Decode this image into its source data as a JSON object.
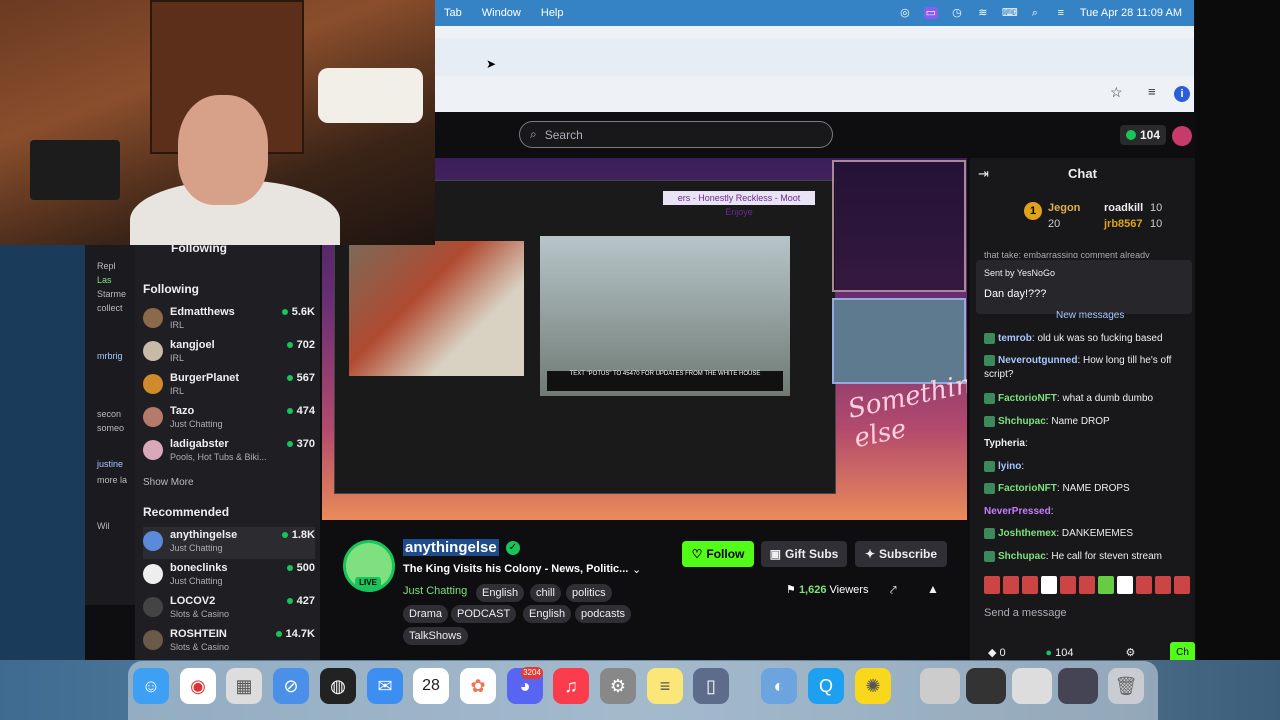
{
  "menubar": {
    "items": [
      "Tab",
      "Window",
      "Help"
    ],
    "datetime": "Tue Apr 28  11:09 AM"
  },
  "twitch": {
    "search_placeholder": "Search",
    "points": "104"
  },
  "sidebar": {
    "following_header": "Following",
    "following_label": "Following",
    "following": [
      {
        "name": "Edmatthews",
        "category": "IRL",
        "viewers": "5.6K"
      },
      {
        "name": "kangjoel",
        "category": "IRL",
        "viewers": "702"
      },
      {
        "name": "BurgerPlanet",
        "category": "IRL",
        "viewers": "567"
      },
      {
        "name": "Tazo",
        "category": "Just Chatting",
        "viewers": "474"
      },
      {
        "name": "ladigabster",
        "category": "Pools, Hot Tubs & Biki...",
        "viewers": "370"
      }
    ],
    "show_more": "Show More",
    "recommended_label": "Recommended",
    "recommended": [
      {
        "name": "anythingelse",
        "category": "Just Chatting",
        "viewers": "1.8K"
      },
      {
        "name": "boneclinks",
        "category": "Just Chatting",
        "viewers": "500"
      },
      {
        "name": "LOCOV2",
        "category": "Slots & Casino",
        "viewers": "427"
      },
      {
        "name": "ROSHTEIN",
        "category": "Slots & Casino",
        "viewers": "14.7K"
      }
    ],
    "strip_lines": [
      "Repl",
      "Las",
      "Starme",
      "collect",
      "mrbrig",
      "secon",
      "someo",
      "justine",
      "more la",
      "Wil"
    ]
  },
  "video": {
    "overlay_title": "ers - Honestly Reckless - Moot Enjoye",
    "signature": "Something else",
    "caption": "TEXT \"POTUS\" TO 45470 FOR UPDATES FROM THE WHITE HOUSE"
  },
  "channel": {
    "name": "anythingelse",
    "live_label": "LIVE",
    "title": "The King Visits his Colony - News, Politic...",
    "category": "Just Chatting",
    "tags_row1": [
      "English",
      "chill",
      "politics"
    ],
    "tags_row2": [
      "Drama",
      "PODCAST",
      "English",
      "podcasts"
    ],
    "tags_row3": [
      "TalkShows"
    ],
    "follow_label": "Follow",
    "gift_label": "Gift Subs",
    "subscribe_label": "Subscribe",
    "viewer_count": "1,626",
    "viewers_label": "Viewers"
  },
  "chat": {
    "title": "Chat",
    "leaderboard": [
      {
        "rank": "1",
        "name": "Jegon",
        "points": "20"
      },
      {
        "name": "roadkill",
        "points": "10"
      },
      {
        "name": "jrb8567",
        "points": "10"
      }
    ],
    "cut_text": "that take: embarrassing comment already",
    "pinned_by": "Sent by YesNoGo",
    "pinned_msg": "Dan day!???",
    "new_messages": "New messages",
    "messages": [
      {
        "user": "temrob",
        "text": "old uk was so fucking based"
      },
      {
        "user": "Neveroutgunned",
        "text": "How long till he's off script?"
      },
      {
        "user": "FactorioNFT",
        "text": "what a dumb dumbo"
      },
      {
        "user": "Shchupac",
        "text": "Name DROP"
      },
      {
        "user": "Typheria",
        "text": ""
      },
      {
        "user": "lyino",
        "text": ""
      },
      {
        "user": "FactorioNFT",
        "text": "NAME DROPS"
      },
      {
        "user": "NeverPressed",
        "text": ""
      },
      {
        "user": "Joshthemex",
        "text": "DANKEMEMES"
      },
      {
        "user": "Shchupac",
        "text": "He call for steven stream"
      }
    ],
    "send_placeholder": "Send a message",
    "footer_left": "0",
    "footer_points": "104",
    "chat_button": "Ch"
  },
  "dock": {
    "calendar_day": "28",
    "discord_badge": "3204",
    "apps": [
      "finder-icon",
      "chrome-icon",
      "launchpad-icon",
      "safari-icon",
      "obs-icon",
      "mail-icon",
      "calendar-icon",
      "photos-icon",
      "discord-icon",
      "music-icon",
      "settings-icon",
      "notes-icon",
      "mirror-icon",
      "preview-icon",
      "quicktime-icon",
      "bulb-icon"
    ]
  }
}
